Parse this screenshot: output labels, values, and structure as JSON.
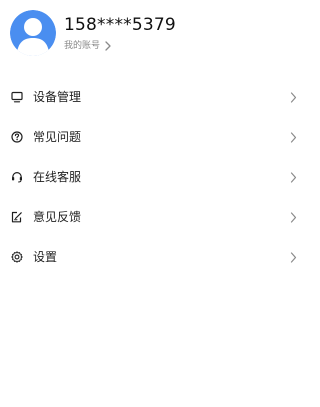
{
  "colors": {
    "avatar_bg": "#4a8ef0",
    "avatar_figure": "#ffffff",
    "text_primary": "#1f1f1f",
    "text_secondary": "#8a8a8a",
    "chevron": "#8a8a8a"
  },
  "profile": {
    "avatar_icon": "user-avatar-icon",
    "phone": "158****5379",
    "account_label": "我的账号",
    "account_icon": "chevron-right-icon"
  },
  "menu": {
    "items": [
      {
        "label": "设备管理",
        "icon": "monitor-icon"
      },
      {
        "label": "常见问题",
        "icon": "question-circle-icon"
      },
      {
        "label": "在线客服",
        "icon": "headset-icon"
      },
      {
        "label": "意见反馈",
        "icon": "feedback-edit-icon"
      },
      {
        "label": "设置",
        "icon": "gear-icon"
      }
    ]
  }
}
